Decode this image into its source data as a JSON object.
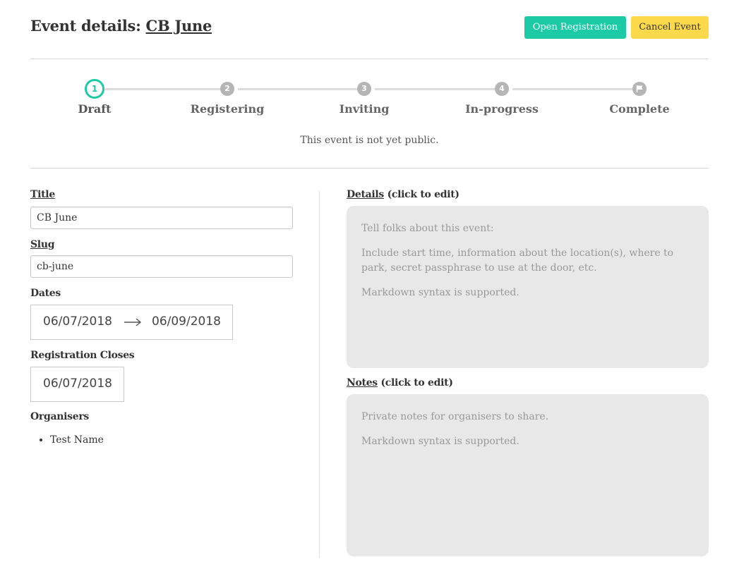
{
  "header": {
    "title_prefix": "Event details: ",
    "event_name": "CB June",
    "open_registration_label": "Open Registration",
    "cancel_event_label": "Cancel Event"
  },
  "steps": [
    {
      "number": "1",
      "label": "Draft",
      "active": true
    },
    {
      "number": "2",
      "label": "Registering",
      "active": false
    },
    {
      "number": "3",
      "label": "Inviting",
      "active": false
    },
    {
      "number": "4",
      "label": "In-progress",
      "active": false
    },
    {
      "icon": "flag-icon",
      "label": "Complete",
      "active": false
    }
  ],
  "status_text": "This event is not yet public.",
  "form": {
    "title_label": "Title",
    "title_value": "CB June",
    "slug_label": "Slug",
    "slug_value": "cb-june",
    "dates_label": "Dates",
    "start_date": "06/07/2018",
    "end_date": "06/09/2018",
    "registration_closes_label": "Registration Closes",
    "registration_closes_date": "06/07/2018",
    "organisers_label": "Organisers",
    "organisers": [
      "Test Name"
    ]
  },
  "details": {
    "label": "Details",
    "hint": " (click to edit)",
    "lines": [
      "Tell folks about this event:",
      "Include start time, information about the location(s), where to park, secret passphrase to use at the door, etc.",
      "Markdown syntax is supported."
    ]
  },
  "notes": {
    "label": "Notes",
    "hint": " (click to edit)",
    "lines": [
      "Private notes for organisers to share.",
      "Markdown syntax is supported."
    ]
  },
  "colors": {
    "accent": "#1dcaa6",
    "warning": "#fbd94b",
    "step_inactive": "#b5b5b5",
    "edit_box_bg": "#e8e8e8"
  }
}
